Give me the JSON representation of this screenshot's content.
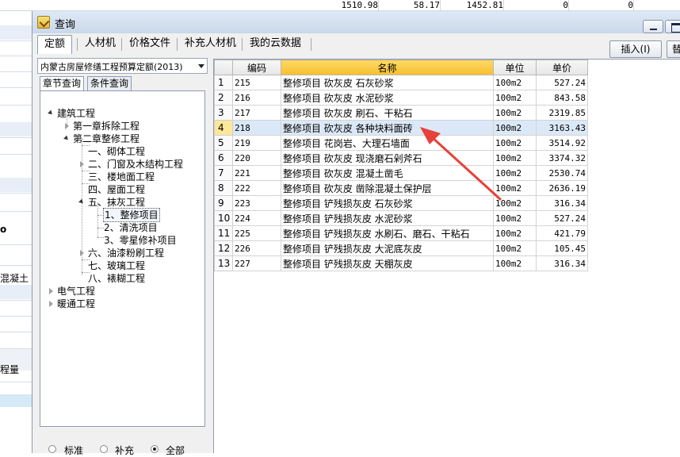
{
  "background": {
    "top_values": [
      "1510.98",
      "58.17",
      "1452.81",
      "0",
      "0"
    ],
    "left_fragments": [
      "o",
      "混凝土",
      "程量"
    ]
  },
  "dialog": {
    "title": "查询",
    "tabs": [
      "定额",
      "人材机",
      "价格文件",
      "补充人材机",
      "我的云数据"
    ],
    "insert_button": "插入(I)",
    "replace_button_fragment": "替",
    "quota_selector": "内蒙古房屋修缮工程预算定额(2013)",
    "sub_tabs": [
      "章节查询",
      "条件查询"
    ],
    "tree": [
      {
        "label": "建筑工程",
        "state": "open"
      },
      {
        "label": "第一章拆除工程",
        "state": "closed"
      },
      {
        "label": "第二章整修工程",
        "state": "open"
      },
      {
        "label": "一、砌体工程",
        "state": "leaf"
      },
      {
        "label": "二、门窗及木结构工程",
        "state": "closed"
      },
      {
        "label": "三、楼地面工程",
        "state": "leaf"
      },
      {
        "label": "四、屋面工程",
        "state": "leaf"
      },
      {
        "label": "五、抹灰工程",
        "state": "open"
      },
      {
        "label": "1、整修项目",
        "state": "selected"
      },
      {
        "label": "2、清洗项目",
        "state": "leaf"
      },
      {
        "label": "3、零星修补项目",
        "state": "leaf"
      },
      {
        "label": "六、油漆粉刷工程",
        "state": "closed"
      },
      {
        "label": "七、玻璃工程",
        "state": "leaf"
      },
      {
        "label": "八、裱糊工程",
        "state": "leaf"
      },
      {
        "label": "电气工程",
        "state": "closed"
      },
      {
        "label": "暖通工程",
        "state": "closed"
      }
    ],
    "filter_options": [
      "标准",
      "补充",
      "全部"
    ],
    "filter_selected": "全部",
    "grid": {
      "headers": [
        "编码",
        "名称",
        "单位",
        "单价"
      ],
      "highlighted_row": 4,
      "rows": [
        {
          "no": "1",
          "code": "215",
          "name": "整修项目 砍灰皮 石灰砂浆",
          "unit": "100m2",
          "price": "527.24"
        },
        {
          "no": "2",
          "code": "216",
          "name": "整修项目 砍灰皮 水泥砂浆",
          "unit": "100m2",
          "price": "843.58"
        },
        {
          "no": "3",
          "code": "217",
          "name": "整修项目 砍灰皮 刷石、干粘石",
          "unit": "100m2",
          "price": "2319.85"
        },
        {
          "no": "4",
          "code": "218",
          "name": "整修项目 砍灰皮 各种块料面砖",
          "unit": "100m2",
          "price": "3163.43"
        },
        {
          "no": "5",
          "code": "219",
          "name": "整修项目 花岗岩、大理石墙面",
          "unit": "100m2",
          "price": "3514.92"
        },
        {
          "no": "6",
          "code": "220",
          "name": "整修项目 砍灰皮 现浇磨石剁斧石",
          "unit": "100m2",
          "price": "3374.32"
        },
        {
          "no": "7",
          "code": "221",
          "name": "整修项目 砍灰皮 混凝土凿毛",
          "unit": "100m2",
          "price": "2530.74"
        },
        {
          "no": "8",
          "code": "222",
          "name": "整修项目 砍灰皮 凿除混凝土保护层",
          "unit": "100m2",
          "price": "2636.19"
        },
        {
          "no": "9",
          "code": "223",
          "name": "整修项目 铲残损灰皮 石灰砂浆",
          "unit": "100m2",
          "price": "316.34"
        },
        {
          "no": "10",
          "code": "224",
          "name": "整修项目 铲残损灰皮 水泥砂浆",
          "unit": "100m2",
          "price": "527.24"
        },
        {
          "no": "11",
          "code": "225",
          "name": "整修项目 铲残损灰皮 水刷石、磨石、干粘石",
          "unit": "100m2",
          "price": "421.79"
        },
        {
          "no": "12",
          "code": "226",
          "name": "整修项目 铲残损灰皮 大泥底灰皮",
          "unit": "100m2",
          "price": "105.45"
        },
        {
          "no": "13",
          "code": "227",
          "name": "整修项目 铲残损灰皮 天棚灰皮",
          "unit": "100m2",
          "price": "316.34"
        }
      ]
    }
  },
  "colors": {
    "grid_header_name": "#f7bf2b",
    "row_highlight": "#dbe8f7",
    "annotation_arrow": "#e8403a"
  }
}
